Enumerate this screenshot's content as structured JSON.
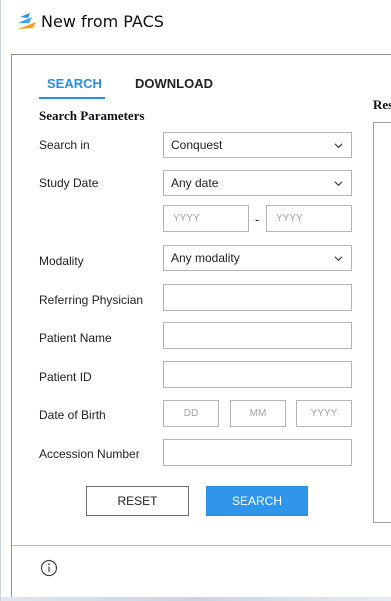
{
  "window": {
    "title": "New from PACS"
  },
  "tabs": [
    {
      "label": "SEARCH",
      "active": true
    },
    {
      "label": "DOWNLOAD",
      "active": false
    }
  ],
  "search_parameters": {
    "heading": "Search Parameters",
    "search_in": {
      "label": "Search in",
      "value": "Conquest"
    },
    "study_date": {
      "label": "Study Date",
      "value": "Any date",
      "from_placeholder": "YYYY",
      "to_placeholder": "YYYY",
      "separator": "-"
    },
    "modality": {
      "label": "Modality",
      "value": "Any modality"
    },
    "referring_physician": {
      "label": "Referring Physician",
      "value": ""
    },
    "patient_name": {
      "label": "Patient Name",
      "value": ""
    },
    "patient_id": {
      "label": "Patient ID",
      "value": ""
    },
    "date_of_birth": {
      "label": "Date of Birth",
      "day_placeholder": "DD",
      "month_placeholder": "MM",
      "year_placeholder": "YYYY"
    },
    "accession_number": {
      "label": "Accession Number",
      "value": ""
    }
  },
  "buttons": {
    "reset": "RESET",
    "search": "SEARCH"
  },
  "results": {
    "heading": "Res"
  },
  "icons": {
    "app": "pacs-app-icon",
    "info": "info-icon",
    "dropdown": "chevron-down-icon"
  },
  "colors": {
    "accent": "#2b8de0",
    "search_button": "#2e95ea"
  }
}
